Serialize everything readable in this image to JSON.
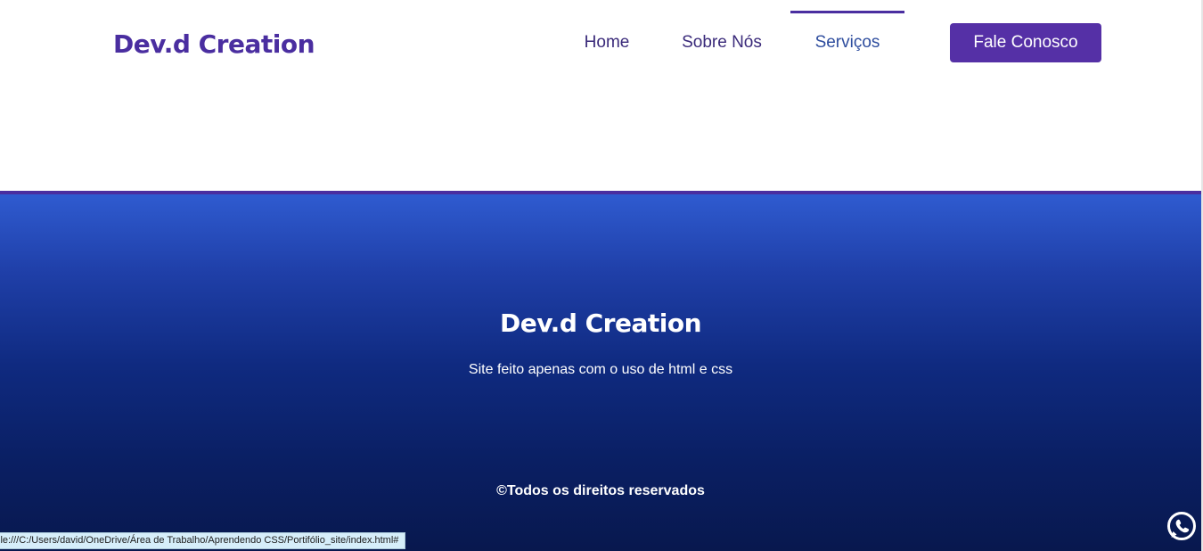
{
  "header": {
    "logo": "Dev.d Creation",
    "nav": [
      {
        "label": "Home"
      },
      {
        "label": "Sobre Nós"
      },
      {
        "label": "Serviços",
        "active": true
      }
    ],
    "cta_label": "Fale Conosco"
  },
  "footer": {
    "title": "Dev.d Creation",
    "subtitle": "Site feito apenas com o uso de html e css",
    "copyright": "©Todos os direitos reservados"
  },
  "status_bar": {
    "url": "ile:///C:/Users/david/OneDrive/Área de Trabalho/Aprendendo CSS/Portifólio_site/index.html#"
  },
  "icons": {
    "whatsapp": "whatsapp-icon"
  },
  "colors": {
    "brand": "#4a2ea0",
    "cta": "#5530a6",
    "footer_top": "#2f5bd0",
    "footer_bottom": "#08184e"
  }
}
